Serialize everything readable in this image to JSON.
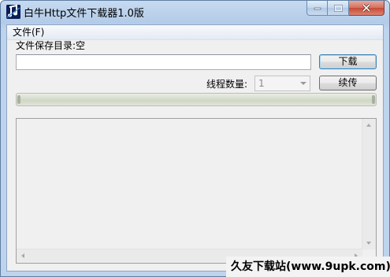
{
  "window": {
    "title": "白牛Http文件下载器1.0版",
    "icon": "music-note-app-icon"
  },
  "menu": {
    "file_label": "文件(F)"
  },
  "form": {
    "save_dir_label": "文件保存目录:空",
    "url_value": "",
    "download_label": "下载",
    "threads_label": "线程数量:",
    "threads_value": "1",
    "resume_label": "续传"
  },
  "progress": {
    "value": 0
  },
  "log": {
    "content": ""
  },
  "watermark": {
    "text": "久友下载站(www.9upk.com)"
  },
  "colors": {
    "progress_fill": "#2bb12b",
    "close_button": "#c74a35"
  }
}
